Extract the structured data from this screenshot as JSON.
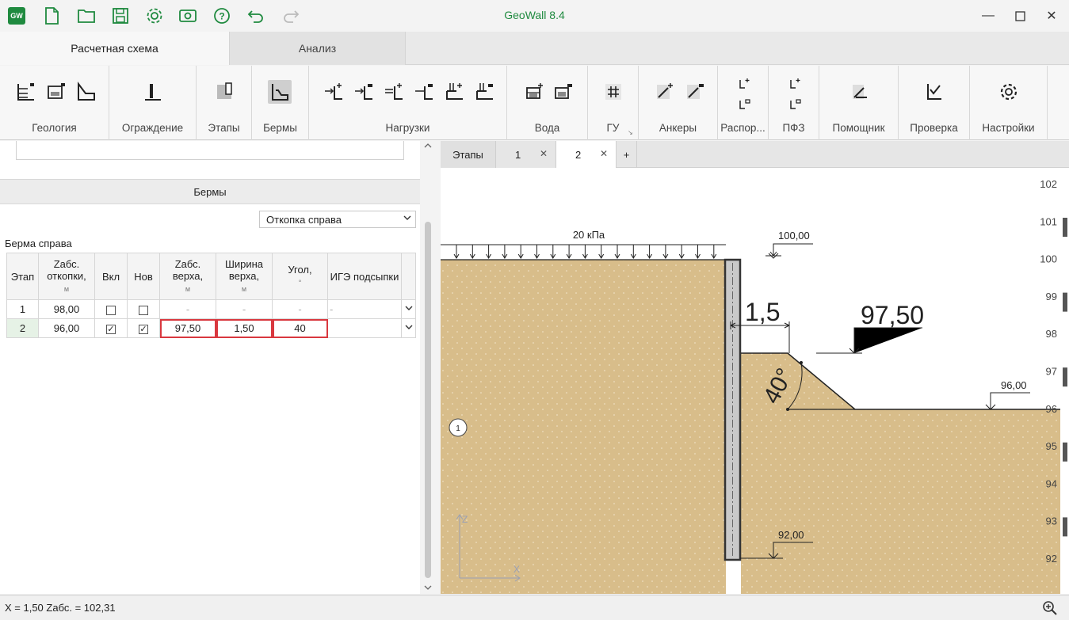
{
  "app": {
    "title": "GeoWall 8.4",
    "logo": "GW"
  },
  "quick_access": [
    "new-file-icon",
    "open-folder-icon",
    "save-icon",
    "settings-gear-icon",
    "screenshot-icon",
    "help-icon",
    "undo-icon",
    "redo-icon"
  ],
  "ribbon_tabs": [
    {
      "label": "Расчетная схема",
      "active": true
    },
    {
      "label": "Анализ",
      "active": false
    }
  ],
  "ribbon_groups": [
    {
      "label": "Геология"
    },
    {
      "label": "Ограждение"
    },
    {
      "label": "Этапы"
    },
    {
      "label": "Бермы"
    },
    {
      "label": "Нагрузки"
    },
    {
      "label": "Вода"
    },
    {
      "label": "ГУ"
    },
    {
      "label": "Анкеры"
    },
    {
      "label": "Распор..."
    },
    {
      "label": "ПФЗ"
    },
    {
      "label": "Помощник"
    },
    {
      "label": "Проверка"
    },
    {
      "label": "Настройки"
    }
  ],
  "left": {
    "section_title": "Бермы",
    "fill_select": "Откопка справа",
    "berm_label": "Берма справа",
    "columns": [
      {
        "title": "Этап",
        "unit": ""
      },
      {
        "title": "Zабс. откопки,",
        "unit": "м"
      },
      {
        "title": "Вкл",
        "unit": ""
      },
      {
        "title": "Нов",
        "unit": ""
      },
      {
        "title": "Zабс. верха,",
        "unit": "м"
      },
      {
        "title": "Ширина верха,",
        "unit": "м"
      },
      {
        "title": "Угол,",
        "unit": "°"
      },
      {
        "title": "ИГЭ подсыпки",
        "unit": ""
      }
    ],
    "rows": [
      {
        "stage": "1",
        "z_exc": "98,00",
        "on": false,
        "new": false,
        "z_top": "-",
        "width": "-",
        "angle": "-",
        "ige": "-"
      },
      {
        "stage": "2",
        "z_exc": "96,00",
        "on": true,
        "new": true,
        "z_top": "97,50",
        "width": "1,50",
        "angle": "40",
        "ige": ""
      }
    ]
  },
  "stage_tabs": [
    {
      "label": "Этапы"
    },
    {
      "label": "1"
    },
    {
      "label": "2",
      "active": true
    },
    {
      "label": "+"
    }
  ],
  "canvas": {
    "load_label": "20 кПа",
    "level_top": "100,00",
    "level_berm": "97,50",
    "level_excavation": "96,00",
    "level_wall_bottom": "92,00",
    "berm_width": "1,5",
    "berm_angle": "40°",
    "soil_layer": "1",
    "axis_z": "Z",
    "axis_x": "X",
    "ruler_ticks": [
      "102",
      "101",
      "100",
      "99",
      "98",
      "97",
      "96",
      "95",
      "94",
      "93",
      "92"
    ],
    "soil_color": "#d8bd8a"
  },
  "status": {
    "text": "X = 1,50  Zабс. = 102,31"
  }
}
